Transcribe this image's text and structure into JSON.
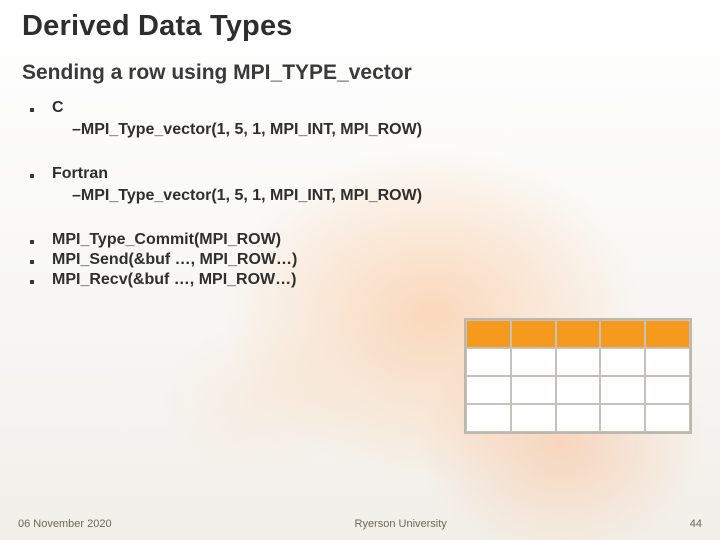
{
  "title": "Derived Data Types",
  "subtitle": "Sending a row using MPI_TYPE_vector",
  "bullets": {
    "c": {
      "label": "C",
      "sub": "–MPI_Type_vector(1, 5, 1, MPI_INT, MPI_ROW)"
    },
    "fortran": {
      "label": "Fortran",
      "sub": "–MPI_Type_vector(1, 5, 1, MPI_INT, MPI_ROW)"
    },
    "commit": "MPI_Type_Commit(MPI_ROW)",
    "send": "MPI_Send(&buf …, MPI_ROW…)",
    "recv": "MPI_Recv(&buf …, MPI_ROW…)"
  },
  "grid": {
    "rows": 4,
    "cols": 5,
    "highlight_row_index": 0,
    "highlight_color": "#f59a1d"
  },
  "footer": {
    "date": "06 November 2020",
    "center": "Ryerson University",
    "pagenum": "44"
  }
}
